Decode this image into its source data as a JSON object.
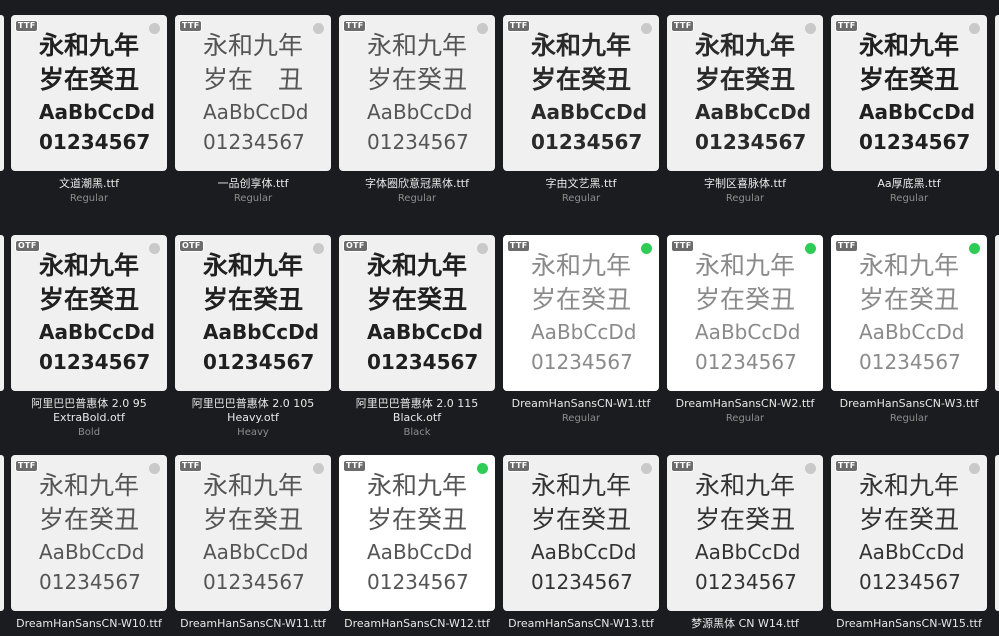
{
  "preview_text": {
    "line1": "永和九年",
    "line2": "岁在癸丑",
    "line3": "AaBbCcDd",
    "line4": "01234567"
  },
  "preview_text_missing_glyph": {
    "line2": "岁在　丑"
  },
  "colors": {
    "background": "#1b1c20",
    "card": "#f0f0f0",
    "active_dot": "#2ecc55",
    "inactive_dot": "#c9c9c9"
  },
  "fonts": [
    {
      "format": "TTF",
      "name": "文道潮黑.ttf",
      "style": "Regular",
      "active": false
    },
    {
      "format": "TTF",
      "name": "一品创享体.ttf",
      "style": "Regular",
      "active": false
    },
    {
      "format": "TTF",
      "name": "字体圈欣意冠黑体.ttf",
      "style": "Regular",
      "active": false
    },
    {
      "format": "TTF",
      "name": "字由文艺黑.ttf",
      "style": "Regular",
      "active": false
    },
    {
      "format": "TTF",
      "name": "字制区喜脉体.ttf",
      "style": "Regular",
      "active": false
    },
    {
      "format": "TTF",
      "name": "Aa厚底黑.ttf",
      "style": "Regular",
      "active": false
    },
    {
      "format": "OTF",
      "name": "阿里巴巴普惠体 2.0 95 ExtraBold.otf",
      "name_line1": "阿里巴巴普惠体 2.0 95",
      "name_line2": "ExtraBold.otf",
      "style": "Bold",
      "active": false
    },
    {
      "format": "OTF",
      "name": "阿里巴巴普惠体 2.0 105 Heavy.otf",
      "name_line1": "阿里巴巴普惠体 2.0 105",
      "name_line2": "Heavy.otf",
      "style": "Heavy",
      "active": false
    },
    {
      "format": "OTF",
      "name": "阿里巴巴普惠体 2.0 115 Black.otf",
      "name_line1": "阿里巴巴普惠体 2.0 115",
      "name_line2": "Black.otf",
      "style": "Black",
      "active": false
    },
    {
      "format": "TTF",
      "name": "DreamHanSansCN-W1.ttf",
      "style": "Regular",
      "active": true
    },
    {
      "format": "TTF",
      "name": "DreamHanSansCN-W2.ttf",
      "style": "Regular",
      "active": true
    },
    {
      "format": "TTF",
      "name": "DreamHanSansCN-W3.ttf",
      "style": "Regular",
      "active": true
    },
    {
      "format": "TTF",
      "name": "DreamHanSansCN-W10.ttf",
      "style": "",
      "active": false
    },
    {
      "format": "TTF",
      "name": "DreamHanSansCN-W11.ttf",
      "style": "",
      "active": false
    },
    {
      "format": "TTF",
      "name": "DreamHanSansCN-W12.ttf",
      "style": "",
      "active": true
    },
    {
      "format": "TTF",
      "name": "DreamHanSansCN-W13.ttf",
      "style": "",
      "active": false
    },
    {
      "format": "TTF",
      "name": "梦源黑体 CN W14.ttf",
      "style": "",
      "active": false
    },
    {
      "format": "TTF",
      "name": "DreamHanSansCN-W15.ttf",
      "style": "",
      "active": false
    }
  ]
}
